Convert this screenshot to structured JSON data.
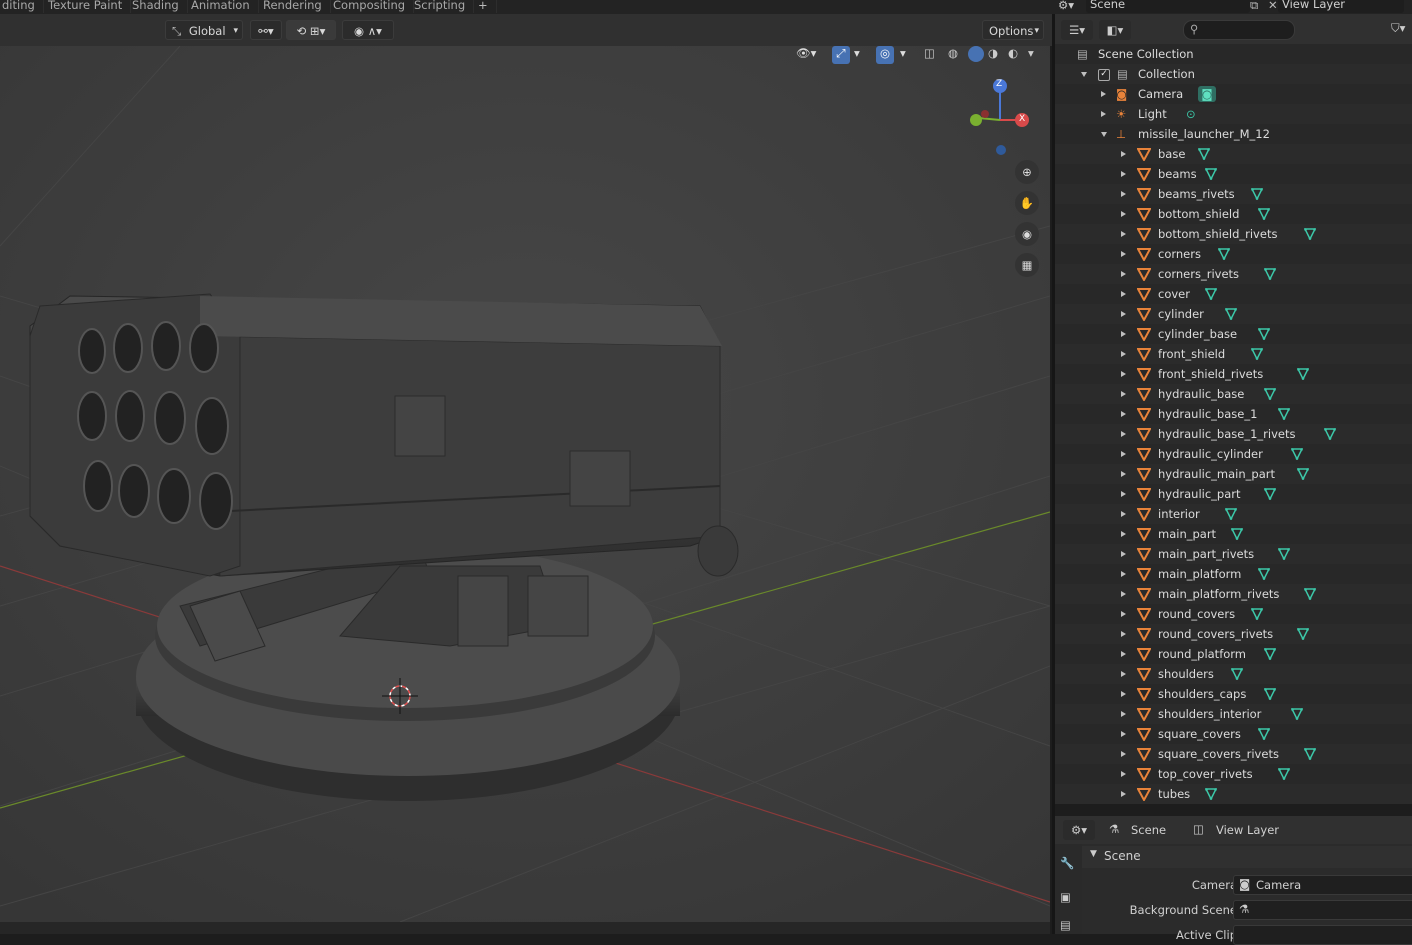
{
  "workspace_tabs": [
    "diting",
    "Texture Paint",
    "Shading",
    "Animation",
    "Rendering",
    "Compositing",
    "Scripting",
    "+"
  ],
  "viewport_header": {
    "orientation": "Global",
    "options_label": "Options"
  },
  "scene_selector": {
    "scene": "Scene",
    "view_layer": "View Layer"
  },
  "outliner": {
    "search_placeholder": "",
    "scene_collection": "Scene Collection",
    "collection": "Collection",
    "camera": "Camera",
    "light": "Light",
    "armature": "missile_launcher_M_12",
    "children": [
      "base",
      "beams",
      "beams_rivets",
      "bottom_shield",
      "bottom_shield_rivets",
      "corners",
      "corners_rivets",
      "cover",
      "cylinder",
      "cylinder_base",
      "front_shield",
      "front_shield_rivets",
      "hydraulic_base",
      "hydraulic_base_1",
      "hydraulic_base_1_rivets",
      "hydraulic_cylinder",
      "hydraulic_main_part",
      "hydraulic_part",
      "interior",
      "main_part",
      "main_part_rivets",
      "main_platform",
      "main_platform_rivets",
      "round_covers",
      "round_covers_rivets",
      "round_platform",
      "shoulders",
      "shoulders_caps",
      "shoulders_interior",
      "square_covers",
      "square_covers_rivets",
      "top_cover_rivets",
      "tubes"
    ]
  },
  "properties": {
    "tab_scene": "Scene",
    "tab_view_layer": "View Layer",
    "panel_title": "Scene",
    "camera_label": "Camera",
    "camera_value": "Camera",
    "background_scene_label": "Background Scene",
    "active_clip_label": "Active Clip"
  },
  "gizmo": {
    "z": "Z",
    "x": "X"
  },
  "colors": {
    "mesh_orange": "#e8833a",
    "mesh_data_teal": "#3cc7a8",
    "accent_blue": "#4772b3"
  }
}
